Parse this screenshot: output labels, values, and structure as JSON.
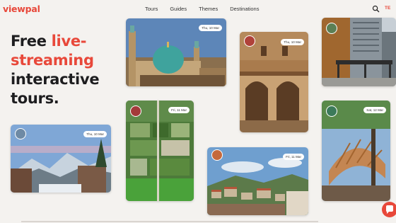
{
  "brand": {
    "logo": "viewpal",
    "accent_color": "#e8483a"
  },
  "nav": {
    "links": [
      {
        "label": "Tours"
      },
      {
        "label": "Guides"
      },
      {
        "label": "Themes"
      },
      {
        "label": "Destinations"
      }
    ],
    "search_icon": "search-icon",
    "language": "TE"
  },
  "hero": {
    "line1_plain": "Free ",
    "line1_accent": "live-",
    "line2_accent": "streaming",
    "line3": "interactive",
    "line4": "tours."
  },
  "tours": [
    {
      "date": "Thu, 10 Mar",
      "scene": "mosque"
    },
    {
      "date": "Thu, 10 Mar",
      "scene": "arcade"
    },
    {
      "date": "",
      "scene": "skyscraper"
    },
    {
      "date": "Thu, 10 Mar",
      "scene": "mountain-town"
    },
    {
      "date": "Fri, 11 Mar",
      "scene": "aerial-fields"
    },
    {
      "date": "Fri, 11 Mar",
      "scene": "hill-town"
    },
    {
      "date": "Sat, 12 Mar",
      "scene": "sculpture"
    }
  ],
  "chat_icon": "chat-icon"
}
